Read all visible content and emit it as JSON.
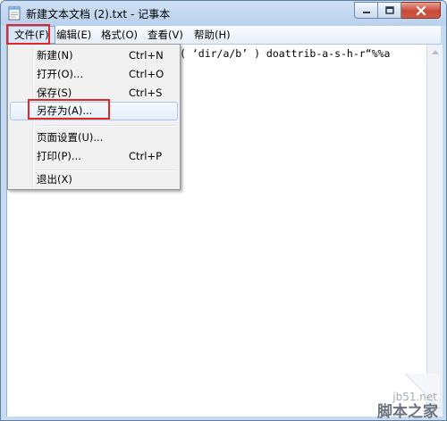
{
  "window": {
    "title": "新建文本文档 (2).txt - 记事本",
    "icon": "notepad-icon"
  },
  "menubar": {
    "items": [
      {
        "label": "文件(F)"
      },
      {
        "label": "编辑(E)"
      },
      {
        "label": "格式(O)"
      },
      {
        "label": "查看(V)"
      },
      {
        "label": "帮助(H)"
      }
    ]
  },
  "file_menu": {
    "items": [
      {
        "label": "新建(N)",
        "shortcut": "Ctrl+N"
      },
      {
        "label": "打开(O)...",
        "shortcut": "Ctrl+O"
      },
      {
        "label": "保存(S)",
        "shortcut": "Ctrl+S"
      },
      {
        "label": "另存为(A)...",
        "shortcut": ""
      },
      {
        "label": "页面设置(U)...",
        "shortcut": ""
      },
      {
        "label": "打印(P)...",
        "shortcut": "Ctrl+P"
      },
      {
        "label": "退出(X)",
        "shortcut": ""
      }
    ]
  },
  "editor": {
    "content": "( ‘dir/a/b’ ) doattrib-a-s-h-r“%%a"
  },
  "watermark": {
    "site": "jb51.net",
    "name": "脚本之家"
  },
  "colors": {
    "highlight_box": "#e02828",
    "title_bar": "#c6daf0",
    "close_button": "#c84a38"
  }
}
